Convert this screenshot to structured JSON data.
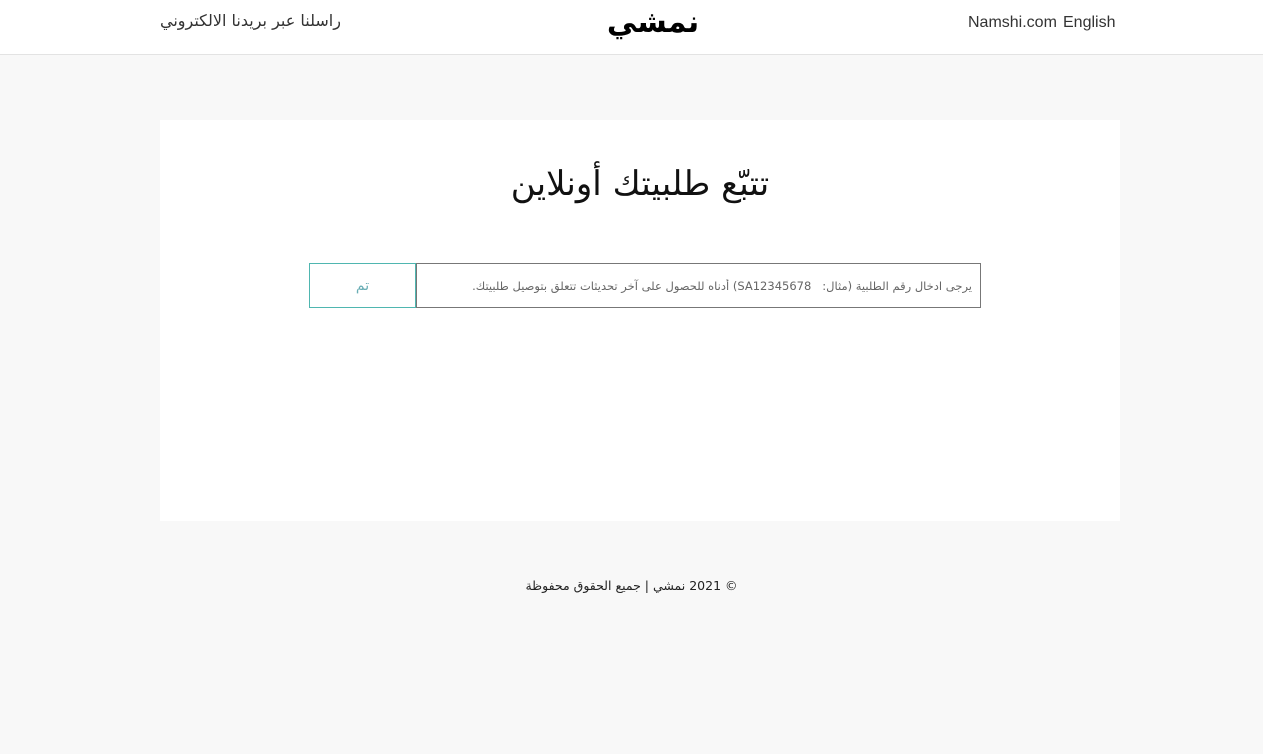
{
  "header": {
    "contact_label": "راسلنا عبر بريدنا الالكتروني",
    "logo_text": "نمشي",
    "site_label": "Namshi.com",
    "language_label": "English"
  },
  "tracker": {
    "title": "تتبّع طلبيتك أونلاين",
    "input_value": "",
    "input_placeholder": "يرجى ادخال رقم الطلبية (مثال:   SA12345678) أدناه للحصول على آخر تحديثات تتعلق بتوصيل طلبيتك.",
    "submit_label": "تم"
  },
  "footer": {
    "copyright": "© 2021 نمشي | جميع الحقوق محفوظة"
  },
  "colors": {
    "page_background": "#f8f8f8",
    "card_background": "#ffffff",
    "button_border": "#4fb6b0",
    "button_text": "#6aaeb5"
  }
}
